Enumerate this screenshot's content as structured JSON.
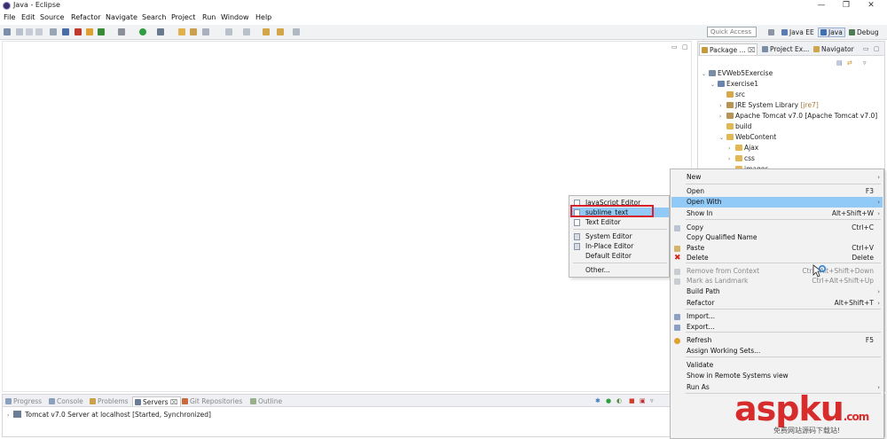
{
  "window": {
    "title": "Java - Eclipse",
    "controls": [
      "—",
      "❐",
      "✕"
    ]
  },
  "menubar": [
    "File",
    "Edit",
    "Source",
    "Refactor",
    "Navigate",
    "Search",
    "Project",
    "Run",
    "Window",
    "Help"
  ],
  "toolbar": {
    "quick_access": "Quick Access",
    "perspectives": [
      "Java EE",
      "Java",
      "Debug"
    ],
    "active_perspective": "Java"
  },
  "explorer": {
    "tabs": [
      "Package ...",
      "Project Ex...",
      "Navigator"
    ],
    "active_tab": "Package ...",
    "tree": [
      {
        "label": "EVWeb5Exercise",
        "deco": "",
        "level": 0,
        "expanded": true,
        "icon": "workingset-icon"
      },
      {
        "label": "Exercise1",
        "deco": "",
        "level": 1,
        "expanded": true,
        "icon": "project-icon"
      },
      {
        "label": "src",
        "deco": "",
        "level": 2,
        "expanded": null,
        "icon": "source-folder-icon"
      },
      {
        "label": "JRE System Library",
        "deco": "[jre7]",
        "level": 2,
        "expanded": false,
        "icon": "library-icon"
      },
      {
        "label": "Apache Tomcat v7.0 [Apache Tomcat v7.0]",
        "deco": "",
        "level": 2,
        "expanded": false,
        "icon": "library-icon"
      },
      {
        "label": "build",
        "deco": "",
        "level": 2,
        "expanded": null,
        "icon": "folder-icon"
      },
      {
        "label": "WebContent",
        "deco": "",
        "level": 2,
        "expanded": true,
        "icon": "folder-icon"
      },
      {
        "label": "Ajax",
        "deco": "",
        "level": 3,
        "expanded": false,
        "icon": "folder-icon"
      },
      {
        "label": "css",
        "deco": "",
        "level": 3,
        "expanded": false,
        "icon": "folder-icon"
      },
      {
        "label": "images",
        "deco": "",
        "level": 3,
        "expanded": false,
        "icon": "folder-icon"
      }
    ]
  },
  "bottom": {
    "tabs": [
      "Progress",
      "Console",
      "Problems",
      "Servers",
      "Git Repositories",
      "Outline"
    ],
    "active_tab": "Servers",
    "server": "Tomcat v7.0 Server at localhost  [Started, Synchronized]"
  },
  "context_menu": {
    "items": [
      {
        "label": "New",
        "shortcut": "",
        "submenu": true,
        "disabled": false,
        "icon": ""
      },
      {
        "label": "Open",
        "shortcut": "F3",
        "submenu": false,
        "disabled": false,
        "icon": ""
      },
      {
        "label": "Open With",
        "shortcut": "",
        "submenu": true,
        "disabled": false,
        "icon": "",
        "highlighted": true
      },
      {
        "label": "Show In",
        "shortcut": "Alt+Shift+W",
        "submenu": true,
        "disabled": false,
        "icon": ""
      },
      {
        "label": "Copy",
        "shortcut": "Ctrl+C",
        "submenu": false,
        "disabled": false,
        "icon": "copy-icon"
      },
      {
        "label": "Copy Qualified Name",
        "shortcut": "",
        "submenu": false,
        "disabled": false,
        "icon": ""
      },
      {
        "label": "Paste",
        "shortcut": "Ctrl+V",
        "submenu": false,
        "disabled": false,
        "icon": "paste-icon"
      },
      {
        "label": "Delete",
        "shortcut": "Delete",
        "submenu": false,
        "disabled": false,
        "icon": "delete-icon"
      },
      {
        "label": "Remove from Context",
        "shortcut": "Ctrl+Alt+Shift+Down",
        "submenu": false,
        "disabled": true,
        "icon": "remove-context-icon"
      },
      {
        "label": "Mark as Landmark",
        "shortcut": "Ctrl+Alt+Shift+Up",
        "submenu": false,
        "disabled": true,
        "icon": "landmark-icon"
      },
      {
        "label": "Build Path",
        "shortcut": "",
        "submenu": true,
        "disabled": false,
        "icon": ""
      },
      {
        "label": "Refactor",
        "shortcut": "Alt+Shift+T",
        "submenu": true,
        "disabled": false,
        "icon": ""
      },
      {
        "label": "Import...",
        "shortcut": "",
        "submenu": false,
        "disabled": false,
        "icon": "import-icon"
      },
      {
        "label": "Export...",
        "shortcut": "",
        "submenu": false,
        "disabled": false,
        "icon": "export-icon"
      },
      {
        "label": "Refresh",
        "shortcut": "F5",
        "submenu": false,
        "disabled": false,
        "icon": "refresh-icon"
      },
      {
        "label": "Assign Working Sets...",
        "shortcut": "",
        "submenu": false,
        "disabled": false,
        "icon": ""
      },
      {
        "label": "Validate",
        "shortcut": "",
        "submenu": false,
        "disabled": false,
        "icon": ""
      },
      {
        "label": "Show in Remote Systems view",
        "shortcut": "",
        "submenu": false,
        "disabled": false,
        "icon": ""
      },
      {
        "label": "Run As",
        "shortcut": "",
        "submenu": true,
        "disabled": false,
        "icon": ""
      }
    ]
  },
  "open_with_submenu": {
    "items": [
      {
        "label": "JavaScript Editor",
        "highlighted": false
      },
      {
        "label": "sublime_text",
        "highlighted": true
      },
      {
        "label": "Text Editor",
        "highlighted": false
      },
      {
        "label": "System Editor",
        "highlighted": false
      },
      {
        "label": "In-Place Editor",
        "highlighted": false
      },
      {
        "label": "Default Editor",
        "highlighted": false
      },
      {
        "label": "Other...",
        "highlighted": false
      }
    ]
  },
  "watermark": {
    "brand": "aspku",
    "dot_com": ".com",
    "tagline": "免费网站源码下载站!"
  },
  "colors": {
    "highlight": "#91c9f7",
    "callout": "#d6202b",
    "watermark": "#d72c2c"
  }
}
